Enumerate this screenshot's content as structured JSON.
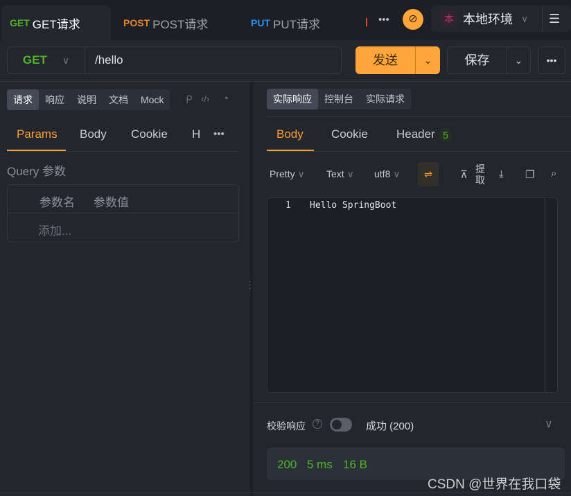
{
  "tabs": [
    {
      "method": "GET",
      "label": "GET请求",
      "color": "#4fb527"
    },
    {
      "method": "POST",
      "label": "POST请求",
      "color": "#e8862a"
    },
    {
      "method": "PUT",
      "label": "PUT请求",
      "color": "#2a8ff0"
    }
  ],
  "environment": {
    "badge": "本",
    "name": "本地环境"
  },
  "request": {
    "method": "GET",
    "url": "/hello",
    "send": "发送",
    "save": "保存"
  },
  "left": {
    "segments": [
      "请求",
      "响应",
      "说明",
      "文档",
      "Mock"
    ],
    "subtabs": [
      "Params",
      "Body",
      "Cookie",
      "H"
    ],
    "query_title": "Query 参数",
    "columns": [
      "参数名",
      "参数值"
    ],
    "add_placeholder": "添加..."
  },
  "right": {
    "segments": [
      "实际响应",
      "控制台",
      "实际请求"
    ],
    "subtabs": [
      "Body",
      "Cookie",
      "Header"
    ],
    "header_count": "5",
    "format": "Pretty",
    "type": "Text",
    "encoding": "utf8",
    "extract": "提取",
    "code_lines": [
      {
        "no": "1",
        "text": "Hello SpringBoot"
      }
    ],
    "validate_label": "校验响应",
    "validate_enabled": false,
    "validate_result": "成功 (200)",
    "status": "200",
    "time": "5 ms",
    "size": "16 B"
  },
  "watermark": "CSDN @世界在我口袋",
  "colors": {
    "accent": "#ff9f2e",
    "success": "#4fb527"
  }
}
